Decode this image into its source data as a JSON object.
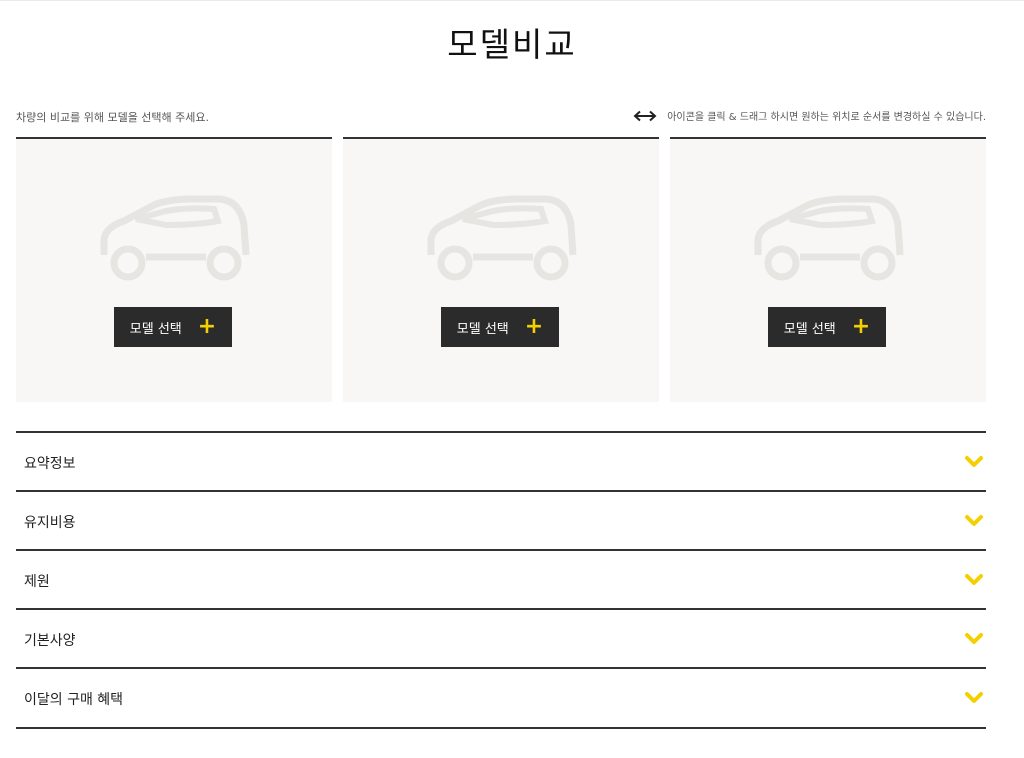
{
  "page": {
    "title": "모델비교",
    "hint_left": "차량의 비교를 위해 모델을 선택해 주세요.",
    "hint_right": "아이콘을 클릭 & 드래그 하시면 원하는 위치로 순서를 변경하실 수 있습니다.",
    "hint_icon": "drag-arrows-icon"
  },
  "slots": [
    {
      "button_label": "모델 선택",
      "icon": "car-placeholder-icon",
      "plus": "+"
    },
    {
      "button_label": "모델 선택",
      "icon": "car-placeholder-icon",
      "plus": "+"
    },
    {
      "button_label": "모델 선택",
      "icon": "car-placeholder-icon",
      "plus": "+"
    }
  ],
  "sections": [
    {
      "label": "요약정보"
    },
    {
      "label": "유지비용"
    },
    {
      "label": "제원"
    },
    {
      "label": "기본사양"
    },
    {
      "label": "이달의 구매 혜택"
    }
  ],
  "colors": {
    "accent": "#f4d000",
    "button_bg": "#2b2b2b",
    "slot_bg": "#f8f7f5",
    "divider": "#333333"
  }
}
